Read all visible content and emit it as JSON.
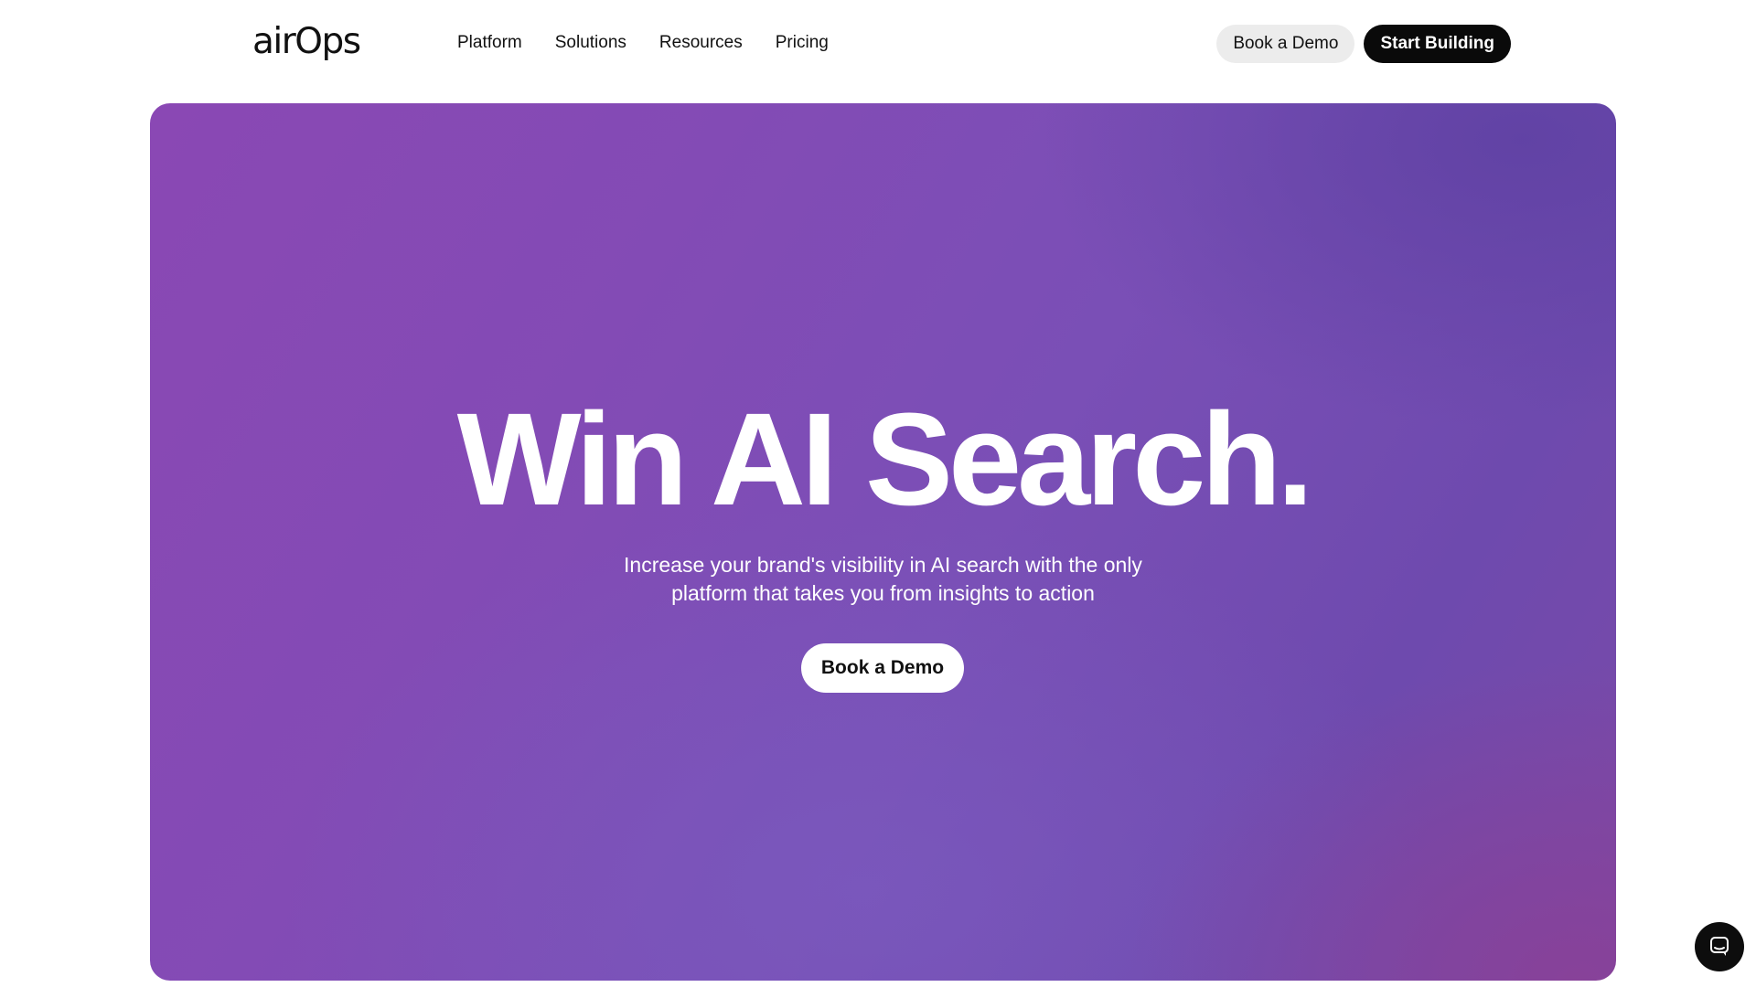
{
  "brand": {
    "logo_text": "airOps"
  },
  "nav": {
    "items": [
      {
        "label": "Platform"
      },
      {
        "label": "Solutions"
      },
      {
        "label": "Resources"
      },
      {
        "label": "Pricing"
      }
    ]
  },
  "header": {
    "book_demo_label": "Book a Demo",
    "start_building_label": "Start Building"
  },
  "hero": {
    "title": "Win AI Search.",
    "subtitle_line1": "Increase your brand's visibility in AI search with the only",
    "subtitle_line2": "platform that takes you from insights to action",
    "cta_label": "Book a Demo"
  },
  "chat": {
    "icon": "chat-bubble-icon"
  },
  "colors": {
    "hero_purple": "#834bb5",
    "hero_violet": "#6e4aae",
    "button_dark": "#0a0a0a",
    "button_light": "#ececec"
  }
}
